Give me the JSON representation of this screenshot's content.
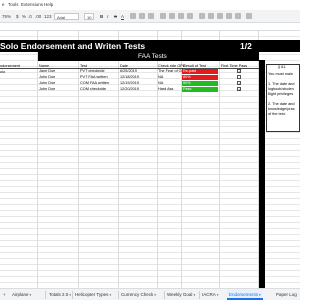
{
  "menu": {
    "items": [
      "e",
      "Tools",
      "Extensions",
      "Help"
    ]
  },
  "toolbar": {
    "zoom": "75%",
    "currency": "$",
    "percent": "%",
    "decimals": ".0",
    "more_decimals": ".00",
    "number_format": "123",
    "font": "Arial",
    "font_size": "10",
    "bold": "B",
    "italic": "I",
    "strike": "S",
    "text_color": "A"
  },
  "sheet": {
    "title": "Solo Endorsement and Writen Tests",
    "fraction": "1/2",
    "percent": "50%",
    "faa_header": "FAA Tests",
    "left_header": "ndorsement",
    "left_cell": "olo",
    "columns": [
      "Name",
      "Test",
      "Date",
      "Check ride OPC",
      "Result of Test",
      "First Time Pass"
    ],
    "rows": [
      {
        "name": "Jane Doe",
        "test": "PVT checkride",
        "date": "6/25/2019",
        "check": "The Fear of God",
        "result": "Re-paid",
        "result_color": "#e21b1b",
        "first": "✓"
      },
      {
        "name": "John Doe",
        "test": "PVT FAA written",
        "date": "12/18/2019",
        "check": "NA",
        "result": "80%",
        "result_color": "#e21b1b",
        "first": ""
      },
      {
        "name": "John Doe",
        "test": "COM FAA written",
        "date": "12/19/2019",
        "check": "NA",
        "result": "90%",
        "result_color": "#22bb22",
        "first": "✓"
      },
      {
        "name": "John Doe",
        "test": "COM checkride",
        "date": "12/20/2019",
        "check": "Hard Ass",
        "result": "Pass",
        "result_color": "#22bb22",
        "first": "✓"
      }
    ],
    "side": {
      "head": "§ 61.",
      "lines": [
        "You must main",
        "",
        "1. The date and",
        "logbook/studen",
        "flight privileges",
        "",
        "2. The date and",
        "knowledge/prac",
        "of the test."
      ]
    }
  },
  "tabs": [
    {
      "label": "+",
      "active": false
    },
    {
      "label": "Airplane",
      "active": false
    },
    {
      "label": "Totals 2.0",
      "active": false
    },
    {
      "label": "Helicopter Types",
      "active": false
    },
    {
      "label": "Currency Check",
      "active": false
    },
    {
      "label": "Weekly Goal",
      "active": false
    },
    {
      "label": "IACRA",
      "active": false
    },
    {
      "label": "Endorsements",
      "active": true
    },
    {
      "label": "Paper Log",
      "active": false
    }
  ]
}
